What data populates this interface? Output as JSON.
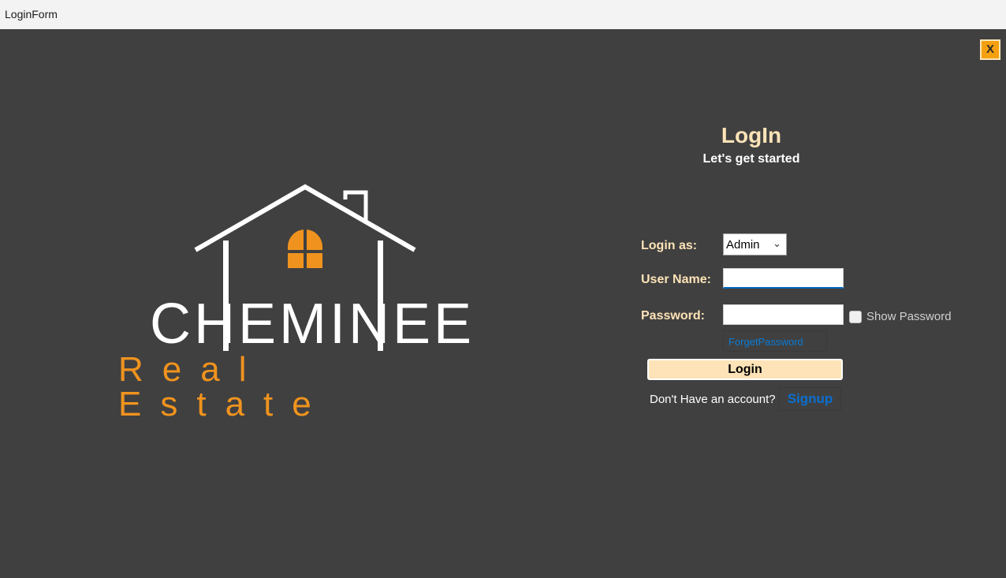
{
  "window": {
    "title": "LoginForm",
    "close_label": "X"
  },
  "logo": {
    "brand_top": "CHEMINEE",
    "brand_bottom": "Real Estate"
  },
  "form": {
    "heading": "LogIn",
    "subheading": "Let's get started",
    "login_as_label": "Login as:",
    "login_as_value": "Admin",
    "username_label": "User Name:",
    "username_value": "",
    "password_label": "Password:",
    "password_value": "",
    "show_password_label": "Show Password",
    "show_password_checked": false,
    "forget_password_label": "ForgetPassword",
    "login_button_label": "Login",
    "no_account_text": "Don't Have an account?",
    "signup_label": "Signup"
  },
  "colors": {
    "background": "#404040",
    "accent": "#f0931e",
    "heading": "#fde3b7",
    "link": "#0a6fd0"
  }
}
